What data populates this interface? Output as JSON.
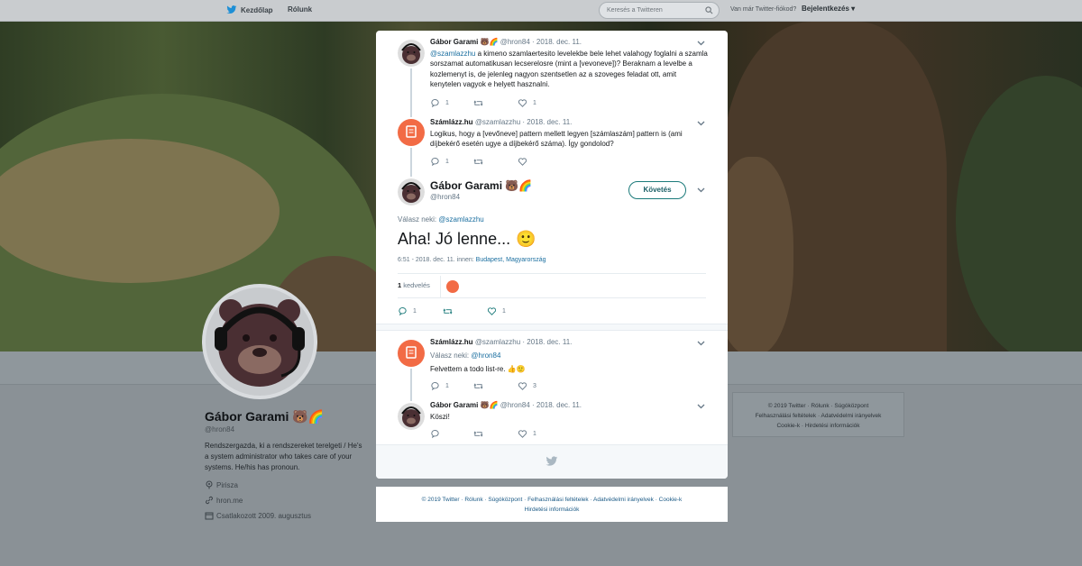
{
  "nav": {
    "home": "Kezdőlap",
    "about": "Rólunk",
    "search_placeholder": "Keresés a Twitteren",
    "account_question": "Van már Twitter-fiókod?",
    "login": "Bejelentkezés"
  },
  "profile": {
    "name": "Gábor Garami 🐻🌈",
    "handle": "@hron84",
    "bio": "Rendszergazda, ki a rendszereket terelgeti / He's a system administrator who takes care of your systems. He/his has pronoun.",
    "location": "Pirisza",
    "website": "hron.me",
    "joined": "Csatlakozott 2009. augusztus"
  },
  "side_footer": {
    "line1": "© 2019 Twitter · Rólunk · Súgóközpont",
    "line2": "Felhasználási feltételek · Adatvédelmi irányelvek",
    "line3": "Cookie-k · Hirdetési információk"
  },
  "tweet1": {
    "name": "Gábor Garami 🐻🌈",
    "handle": "@hron84",
    "date": "· 2018. dec. 11.",
    "mention": "@szamlazzhu",
    "text": " a kimeno szamlaertesito levelekbe bele lehet valahogy foglalni a szamla sorszamat automatikusan lecserelosre (mint a [vevoneve])? Beraknam a levelbe a kozlemenyt is, de jelenleg nagyon szentsetlen az a szoveges feladat ott, amit kenytelen vagyok e helyett hasznalni.",
    "replies": "1",
    "retweets": "",
    "likes": "1"
  },
  "tweet2": {
    "name": "Számlázz.hu",
    "handle": "@szamlazzhu",
    "date": "· 2018. dec. 11.",
    "text": "Logikus, hogy a [vevőneve] pattern mellett legyen [számlaszám] pattern is (ami díjbekérő esetén ugye a díjbekérő száma). Így gondolod?",
    "replies": "1",
    "retweets": "",
    "likes": ""
  },
  "main_tweet": {
    "name": "Gábor Garami 🐻🌈",
    "handle": "@hron84",
    "follow": "Követés",
    "replying_label": "Válasz neki:",
    "replying_to": "@szamlazzhu",
    "text": "Aha! Jó lenne...",
    "emoji": "🙂",
    "time": "6:51 - 2018. dec. 11. innen:",
    "place": "Budapest, Magyarország",
    "likes_count": "1",
    "likes_label": "kedvelés",
    "replies": "1",
    "retweets": "",
    "likes": "1"
  },
  "tweet3": {
    "name": "Számlázz.hu",
    "handle": "@szamlazzhu",
    "date": "· 2018. dec. 11.",
    "replying_label": "Válasz neki:",
    "replying_to": "@hron84",
    "text": "Felvettem a todo list-re. 👍🙂",
    "replies": "1",
    "retweets": "",
    "likes": "3"
  },
  "tweet4": {
    "name": "Gábor Garami 🐻🌈",
    "handle": "@hron84",
    "date": "· 2018. dec. 11.",
    "text": "Köszi!",
    "replies": "",
    "retweets": "",
    "likes": "1"
  },
  "bottom_footer": {
    "line1": "© 2019 Twitter · Rólunk · Súgóközpont · Felhasználási feltételek · Adatvédelmi irányelvek · Cookie-k",
    "line2": "Hirdetési információk"
  },
  "colors": {
    "accent": "#1b7a7a",
    "szamlazz": "#f26b45",
    "link": "#1b6fa0"
  }
}
